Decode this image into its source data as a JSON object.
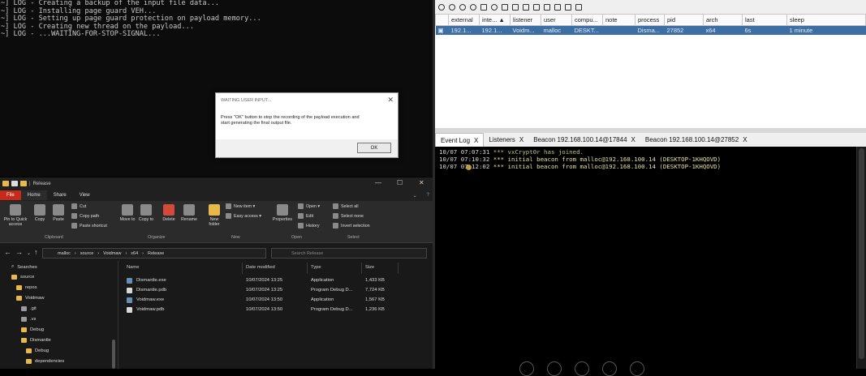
{
  "terminal": {
    "lines": [
      "~] LOG - Creating a backup of the input file data...",
      "~] LOG - Installing page guard VEH...",
      "~] LOG - Setting up page guard protection on payload memory...",
      "~] LOG - Creating new thread on the payload...",
      "~] LOG - ...WAITING-FOR-STOP-SIGNAL..."
    ]
  },
  "dialog": {
    "title": "WAITING USER INPUT...",
    "message_line1": "Press \"OK\" button to stop the recording of the payload execution and",
    "message_line2": "start generating the final output file.",
    "ok": "OK",
    "close": "✕"
  },
  "explorer": {
    "title": "Release",
    "tabs": {
      "file": "File",
      "home": "Home",
      "share": "Share",
      "view": "View"
    },
    "ribbon": {
      "pin": "Pin to Quick access",
      "copy": "Copy",
      "paste": "Paste",
      "cut": "Cut",
      "copy_path": "Copy path",
      "paste_shortcut": "Paste shortcut",
      "move_to": "Move to",
      "copy_to": "Copy to",
      "delete": "Delete",
      "rename": "Rename",
      "new_folder": "New folder",
      "new_item": "New item ▾",
      "easy_access": "Easy access ▾",
      "properties": "Properties",
      "open": "Open ▾",
      "edit": "Edit",
      "history": "History",
      "select_all": "Select all",
      "select_none": "Select none",
      "invert_selection": "Invert selection",
      "groups": {
        "clipboard": "Clipboard",
        "organize": "Organize",
        "new": "New",
        "open": "Open",
        "select": "Select"
      }
    },
    "address": {
      "parts": [
        "malloc",
        "source",
        "Voidmaw",
        "x64",
        "Release"
      ]
    },
    "search_placeholder": "Search Release",
    "nav": [
      "Searches",
      "source",
      "repos",
      "Voidmaw",
      ".git",
      ".vs",
      "Debug",
      "Dismantle",
      "Debug",
      "dependencies"
    ],
    "columns": {
      "name": "Name",
      "date": "Date modified",
      "type": "Type",
      "size": "Size"
    },
    "files": [
      {
        "name": "Dismantle.exe",
        "date": "10/07/2024 13:25",
        "type": "Application",
        "size": "1,433 KB",
        "kind": "exe"
      },
      {
        "name": "Dismantle.pdb",
        "date": "10/07/2024 13:25",
        "type": "Program Debug D...",
        "size": "7,724 KB",
        "kind": "pdb"
      },
      {
        "name": "Voidmaw.exe",
        "date": "10/07/2024 13:50",
        "type": "Application",
        "size": "1,567 KB",
        "kind": "exe"
      },
      {
        "name": "Voidmaw.pdb",
        "date": "10/07/2024 13:50",
        "type": "Program Debug D...",
        "size": "1,236 KB",
        "kind": "pdb"
      }
    ]
  },
  "beacons": {
    "columns": [
      "",
      "external",
      "inte... ▲",
      "listener",
      "user",
      "compu...",
      "note",
      "process",
      "pid",
      "arch",
      "last",
      "sleep"
    ],
    "rows": [
      [
        "▣",
        "192.1...",
        "192.1...",
        "Voidm...",
        "malloc",
        "DESKT...",
        "",
        "Disma...",
        "27852",
        "x64",
        "6s",
        "1 minute"
      ]
    ]
  },
  "eventlog": {
    "tabs": [
      {
        "label": "Event Log",
        "close": "X"
      },
      {
        "label": "Listeners",
        "close": "X"
      },
      {
        "label": "Beacon 192.168.100.14@17844",
        "close": "X"
      },
      {
        "label": "Beacon 192.168.100.14@27852",
        "close": "X"
      }
    ],
    "lines": [
      {
        "time": "10/07 07:07:31",
        "msg": " *** vxCrypt0r has joined."
      },
      {
        "time": "10/07 07:10:32",
        "msg": " *** initial beacon from malloc@192.168.100.14 (DESKTOP-1KHQOVD)"
      },
      {
        "time": "10/07 07:12:02",
        "msg": " *** initial beacon from malloc@192.168.100.14 (DESKTOP-1KHQOVD)"
      }
    ]
  }
}
